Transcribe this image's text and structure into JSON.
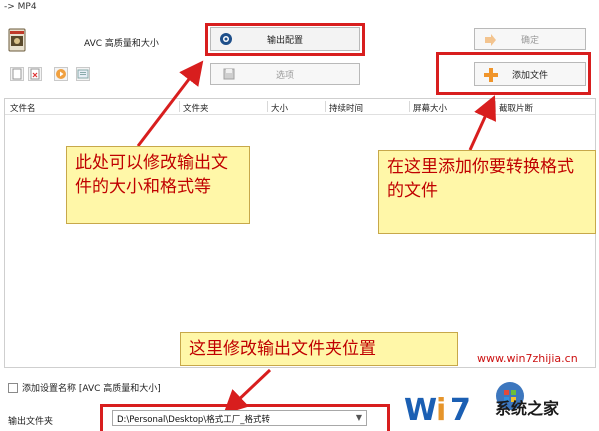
{
  "window": {
    "title": "-> MP4"
  },
  "profile": {
    "label": "AVC 高质量和大小"
  },
  "buttons": {
    "output_config": "输出配置",
    "options": "选项",
    "ok": "确定",
    "add_file": "添加文件"
  },
  "table": {
    "columns": [
      "文件名",
      "文件夹",
      "大小",
      "持续时间",
      "屏幕大小",
      "截取片断"
    ]
  },
  "annotations": {
    "output_format_note": "此处可以修改输出文件的大小和格式等",
    "add_file_note": "在这里添加你要转换格式的文件",
    "output_folder_note": "这里修改输出文件夹位置"
  },
  "options": {
    "add_setting_name_label": "添加设置名称 [AVC 高质量和大小]",
    "add_setting_name_checked": false
  },
  "output": {
    "folder_label": "输出文件夹",
    "folder_path": "D:\\Personal\\Desktop\\格式工厂_格式转"
  },
  "watermark": {
    "site": "www.win7zhijia.cn",
    "brand": "系统之家"
  },
  "colors": {
    "highlight_red": "#d81e1e",
    "note_bg": "#fff7a8",
    "note_text": "#c00000",
    "add_icon_orange": "#f0952b"
  }
}
